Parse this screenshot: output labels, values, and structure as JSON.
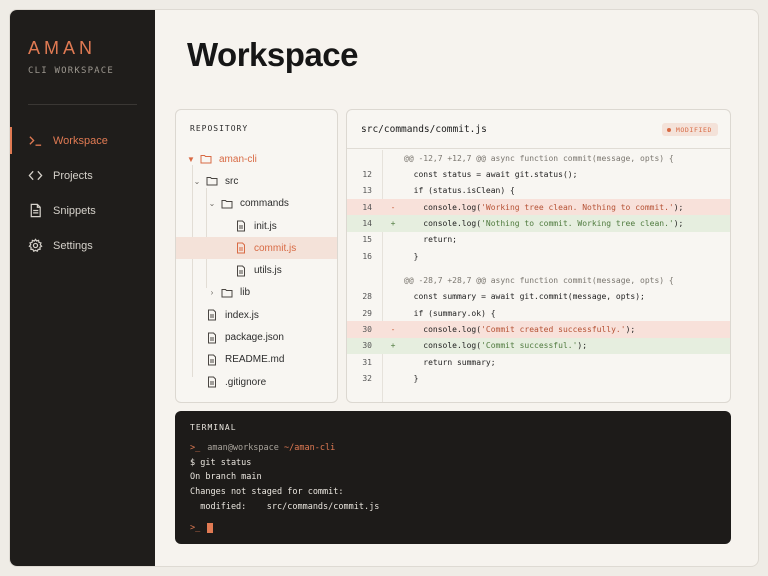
{
  "sidebar": {
    "brand": "AMAN",
    "subtitle": "CLI WORKSPACE",
    "accent": "#e07a53",
    "items": [
      {
        "label": "Workspace",
        "icon": "terminal-icon",
        "active": true
      },
      {
        "label": "Projects",
        "icon": "code-brackets-icon",
        "active": false
      },
      {
        "label": "Snippets",
        "icon": "file-icon",
        "active": false
      },
      {
        "label": "Settings",
        "icon": "gear-icon",
        "active": false
      }
    ]
  },
  "main": {
    "title": "Workspace"
  },
  "repository": {
    "header": "REPOSITORY",
    "tree": [
      {
        "name": "aman-cli",
        "type": "folder",
        "expanded": true
      },
      {
        "name": "src",
        "type": "folder",
        "expanded": true
      },
      {
        "name": "commands",
        "type": "folder",
        "expanded": true
      },
      {
        "name": "init.js",
        "type": "file"
      },
      {
        "name": "commit.js",
        "type": "file",
        "selected": true
      },
      {
        "name": "utils.js",
        "type": "file"
      },
      {
        "name": "lib",
        "type": "folder",
        "expanded": false
      },
      {
        "name": "index.js",
        "type": "file"
      },
      {
        "name": "package.json",
        "type": "file"
      },
      {
        "name": "README.md",
        "type": "file"
      },
      {
        "name": ".gitignore",
        "type": "file"
      }
    ]
  },
  "diff": {
    "path": "src/commands/commit.js",
    "badge": "MODIFIED",
    "lines": [
      {
        "kind": "hunk",
        "ln": "",
        "mark": "",
        "pre": "@@ -12,7 +12,7 @@ async function commit(message, opts) {",
        "str": "",
        "post": ""
      },
      {
        "kind": "ctx",
        "ln": "12",
        "mark": "",
        "pre": "  const status = await git.status();",
        "str": "",
        "post": ""
      },
      {
        "kind": "ctx",
        "ln": "13",
        "mark": "",
        "pre": "  if (status.isClean) {",
        "str": "",
        "post": ""
      },
      {
        "kind": "del",
        "ln": "14",
        "mark": "-",
        "pre": "    console.log(",
        "str": "'Working tree clean. Nothing to commit.'",
        "post": ");"
      },
      {
        "kind": "add",
        "ln": "14",
        "mark": "+",
        "pre": "    console.log(",
        "str": "'Nothing to commit. Working tree clean.'",
        "post": ");"
      },
      {
        "kind": "ctx",
        "ln": "15",
        "mark": "",
        "pre": "    return;",
        "str": "",
        "post": ""
      },
      {
        "kind": "ctx",
        "ln": "16",
        "mark": "",
        "pre": "  }",
        "str": "",
        "post": ""
      },
      {
        "kind": "gap",
        "ln": "",
        "mark": "",
        "pre": "",
        "str": "",
        "post": ""
      },
      {
        "kind": "hunk",
        "ln": "",
        "mark": "",
        "pre": "@@ -28,7 +28,7 @@ async function commit(message, opts) {",
        "str": "",
        "post": ""
      },
      {
        "kind": "ctx",
        "ln": "28",
        "mark": "",
        "pre": "  const summary = await git.commit(message, opts);",
        "str": "",
        "post": ""
      },
      {
        "kind": "ctx",
        "ln": "29",
        "mark": "",
        "pre": "  if (summary.ok) {",
        "str": "",
        "post": ""
      },
      {
        "kind": "del",
        "ln": "30",
        "mark": "-",
        "pre": "    console.log(",
        "str": "'Commit created successfully.'",
        "post": ");"
      },
      {
        "kind": "add",
        "ln": "30",
        "mark": "+",
        "pre": "    console.log(",
        "str": "'Commit successful.'",
        "post": ");"
      },
      {
        "kind": "ctx",
        "ln": "31",
        "mark": "",
        "pre": "    return summary;",
        "str": "",
        "post": ""
      },
      {
        "kind": "ctx",
        "ln": "32",
        "mark": "",
        "pre": "  }",
        "str": "",
        "post": ""
      }
    ]
  },
  "terminal": {
    "header": "TERMINAL",
    "prompt_symbol": ">_",
    "prompt_user": "aman@workspace",
    "prompt_path": "~/aman-cli",
    "lines": [
      "$ git status",
      "On branch main",
      "Changes not staged for commit:",
      "  modified:    src/commands/commit.js"
    ]
  }
}
